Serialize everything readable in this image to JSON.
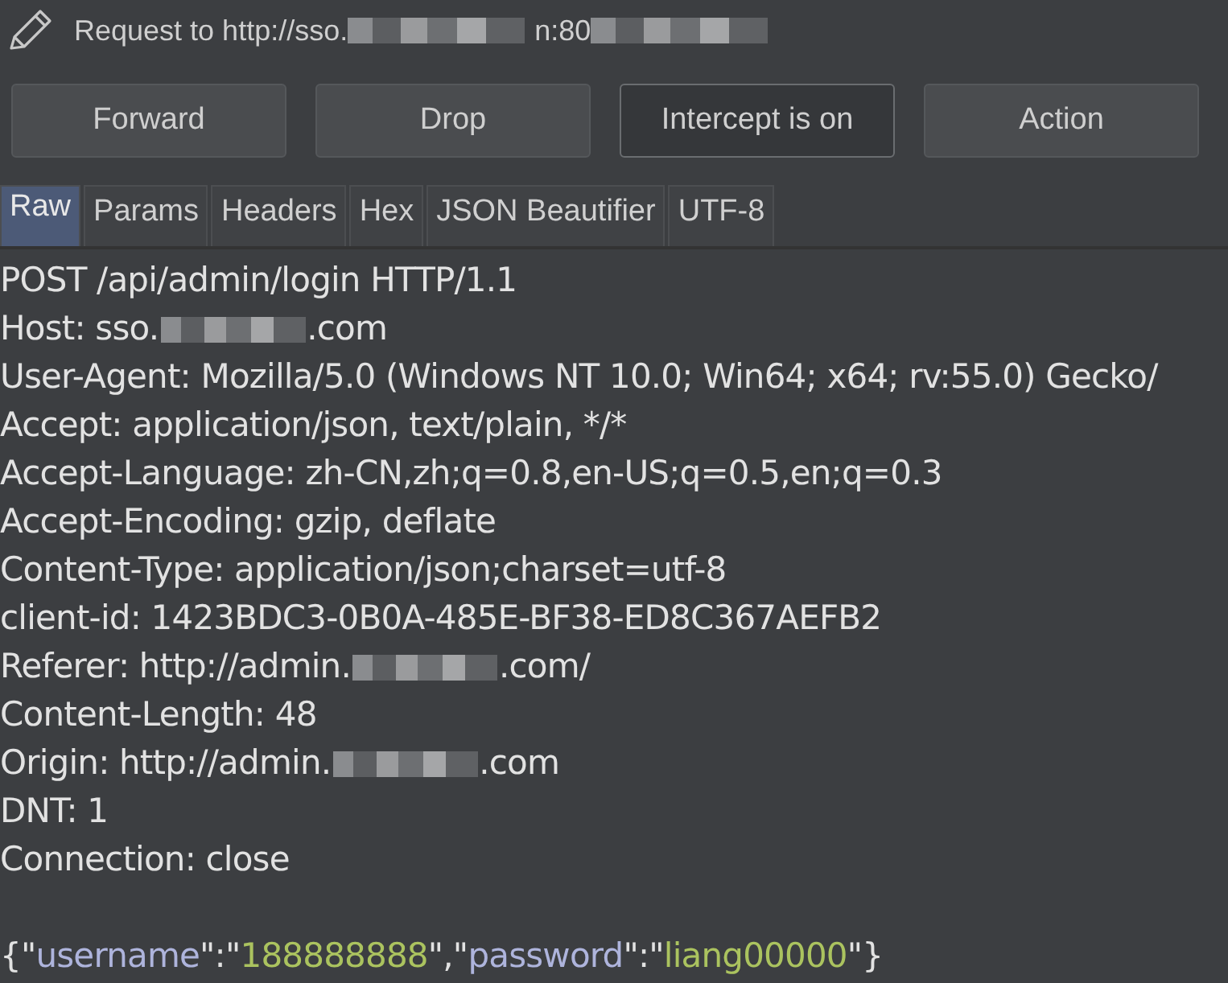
{
  "title": [
    {
      "kind": "text",
      "text": "Request to http://sso."
    },
    {
      "kind": "redacted"
    },
    {
      "kind": "text",
      "text": "n:80"
    },
    {
      "kind": "redacted"
    }
  ],
  "buttons": [
    {
      "label": "Forward",
      "pressed": false
    },
    {
      "label": "Drop",
      "pressed": false
    },
    {
      "label": "Intercept is on",
      "pressed": true
    },
    {
      "label": "Action",
      "pressed": false
    }
  ],
  "tabs": [
    {
      "label": "Raw",
      "selected": true
    },
    {
      "label": "Params",
      "selected": false
    },
    {
      "label": "Headers",
      "selected": false
    },
    {
      "label": "Hex",
      "selected": false
    },
    {
      "label": "JSON Beautifier",
      "selected": false
    },
    {
      "label": "UTF-8",
      "selected": false
    }
  ],
  "lines": [
    [
      {
        "kind": "text",
        "text": "POST /api/admin/login HTTP/1.1"
      }
    ],
    [
      {
        "kind": "text",
        "text": "Host: sso."
      },
      {
        "kind": "redacted"
      },
      {
        "kind": "text",
        "text": ".com"
      }
    ],
    [
      {
        "kind": "text",
        "text": "User-Agent: Mozilla/5.0 (Windows NT 10.0; Win64; x64; rv:55.0) Gecko/"
      }
    ],
    [
      {
        "kind": "text",
        "text": "Accept: application/json, text/plain, */*"
      }
    ],
    [
      {
        "kind": "text",
        "text": "Accept-Language: zh-CN,zh;q=0.8,en-US;q=0.5,en;q=0.3"
      }
    ],
    [
      {
        "kind": "text",
        "text": "Accept-Encoding: gzip, deflate"
      }
    ],
    [
      {
        "kind": "text",
        "text": "Content-Type: application/json;charset=utf-8"
      }
    ],
    [
      {
        "kind": "text",
        "text": "client-id: 1423BDC3-0B0A-485E-BF38-ED8C367AEFB2"
      }
    ],
    [
      {
        "kind": "text",
        "text": "Referer: http://admin."
      },
      {
        "kind": "redacted"
      },
      {
        "kind": "text",
        "text": ".com/"
      }
    ],
    [
      {
        "kind": "text",
        "text": "Content-Length: 48"
      }
    ],
    [
      {
        "kind": "text",
        "text": "Origin: http://admin."
      },
      {
        "kind": "redacted"
      },
      {
        "kind": "text",
        "text": ".com"
      }
    ],
    [
      {
        "kind": "text",
        "text": "DNT: 1"
      }
    ],
    [
      {
        "kind": "text",
        "text": "Connection: close"
      }
    ]
  ],
  "body": [
    {
      "kind": "text",
      "text": "{\""
    },
    {
      "kind": "key",
      "text": "username"
    },
    {
      "kind": "text",
      "text": "\":\""
    },
    {
      "kind": "value",
      "text": "188888888"
    },
    {
      "kind": "text",
      "text": "\",\""
    },
    {
      "kind": "key",
      "text": "password"
    },
    {
      "kind": "text",
      "text": "\":\""
    },
    {
      "kind": "value",
      "text": "liang00000"
    },
    {
      "kind": "text",
      "text": "\"}"
    }
  ]
}
